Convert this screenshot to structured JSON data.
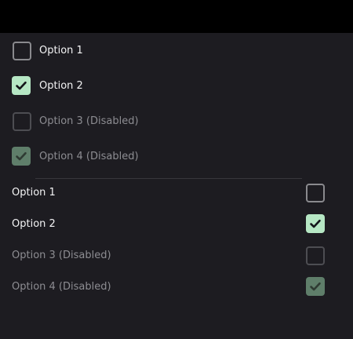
{
  "group_left": {
    "options": [
      {
        "label": "Option 1",
        "checked": false,
        "disabled": false
      },
      {
        "label": "Option 2",
        "checked": true,
        "disabled": false
      },
      {
        "label": "Option 3 (Disabled)",
        "checked": false,
        "disabled": true
      },
      {
        "label": "Option 4 (Disabled)",
        "checked": true,
        "disabled": true
      }
    ]
  },
  "group_right": {
    "options": [
      {
        "label": "Option 1",
        "checked": false,
        "disabled": false
      },
      {
        "label": "Option 2",
        "checked": true,
        "disabled": false
      },
      {
        "label": "Option 3 (Disabled)",
        "checked": false,
        "disabled": true
      },
      {
        "label": "Option 4 (Disabled)",
        "checked": true,
        "disabled": true
      }
    ]
  },
  "colors": {
    "background": "#1d1c21",
    "top_bar": "#000000",
    "accent": "#b6e7c4",
    "accent_disabled": "#5f7e6a",
    "text": "#f4f4f5",
    "text_disabled": "#8d8d92"
  }
}
